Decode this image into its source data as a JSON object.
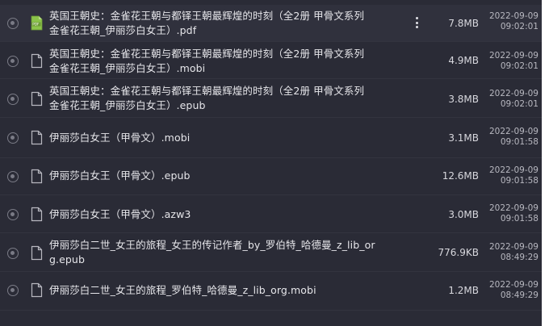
{
  "files": [
    {
      "line1": "英国王朝史：金雀花王朝与都铎王朝最辉煌的时刻（全2册 甲骨文系列",
      "line2": "金雀花王朝_伊丽莎白女王）.pdf",
      "size": "7.8MB",
      "date": "2022-09-09",
      "time": "09:02:01",
      "icon": "pdf-file-icon"
    },
    {
      "line1": "英国王朝史：金雀花王朝与都铎王朝最辉煌的时刻（全2册 甲骨文系列",
      "line2": "金雀花王朝_伊丽莎白女王）.mobi",
      "size": "4.9MB",
      "date": "2022-09-09",
      "time": "09:02:01",
      "icon": "file-icon"
    },
    {
      "line1": "英国王朝史：金雀花王朝与都铎王朝最辉煌的时刻（全2册 甲骨文系列",
      "line2": "金雀花王朝_伊丽莎白女王）.epub",
      "size": "3.8MB",
      "date": "2022-09-09",
      "time": "09:02:01",
      "icon": "file-icon"
    },
    {
      "line1": "伊丽莎白女王（甲骨文）.mobi",
      "line2": "",
      "size": "3.1MB",
      "date": "2022-09-09",
      "time": "09:01:58",
      "icon": "file-icon"
    },
    {
      "line1": "伊丽莎白女王（甲骨文）.epub",
      "line2": "",
      "size": "12.6MB",
      "date": "2022-09-09",
      "time": "09:01:58",
      "icon": "file-icon"
    },
    {
      "line1": "伊丽莎白女王（甲骨文）.azw3",
      "line2": "",
      "size": "3.0MB",
      "date": "2022-09-09",
      "time": "09:01:58",
      "icon": "file-icon"
    },
    {
      "line1": "伊丽莎白二世_女王的旅程_女王的传记作者_by_罗伯特_哈德曼_z_lib_or",
      "line2": "g.epub",
      "size": "776.9KB",
      "date": "2022-09-09",
      "time": "08:49:29",
      "icon": "file-icon"
    },
    {
      "line1": "伊丽莎白二世_女王的旅程_罗伯特_哈德曼_z_lib_org.mobi",
      "line2": "",
      "size": "1.2MB",
      "date": "2022-09-09",
      "time": "08:49:29",
      "icon": "file-icon"
    }
  ],
  "colors": {
    "panel_bg": "#2a2b36",
    "pdf_icon": "#8bc34a",
    "text": "#e6e6ea"
  }
}
